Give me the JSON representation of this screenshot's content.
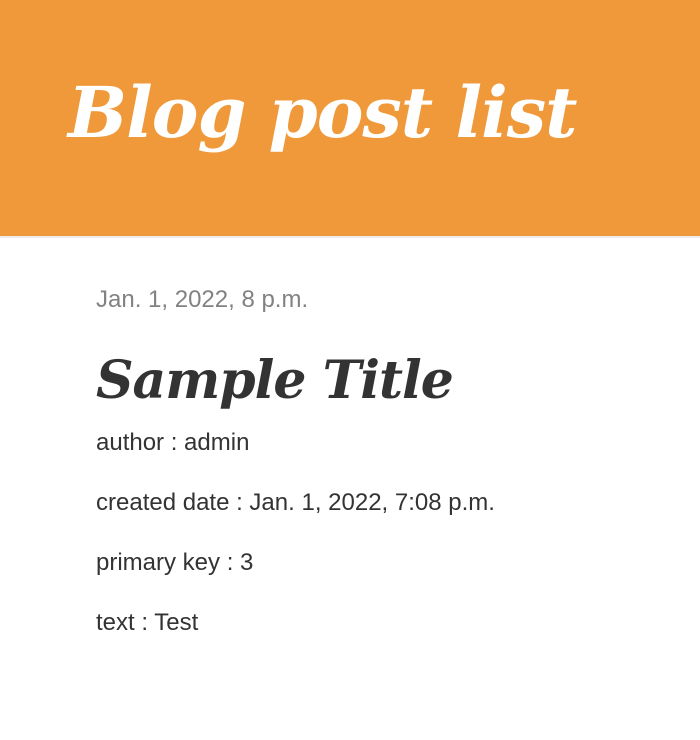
{
  "header": {
    "title": "Blog post list",
    "background_color": "#f0993a"
  },
  "post": {
    "published_date": "Jan. 1, 2022, 8 p.m.",
    "title": "Sample Title",
    "fields": {
      "author": "author : admin",
      "created_date": "created date : Jan. 1, 2022, 7:08 p.m.",
      "primary_key": "primary key : 3",
      "text": "text : Test"
    }
  }
}
